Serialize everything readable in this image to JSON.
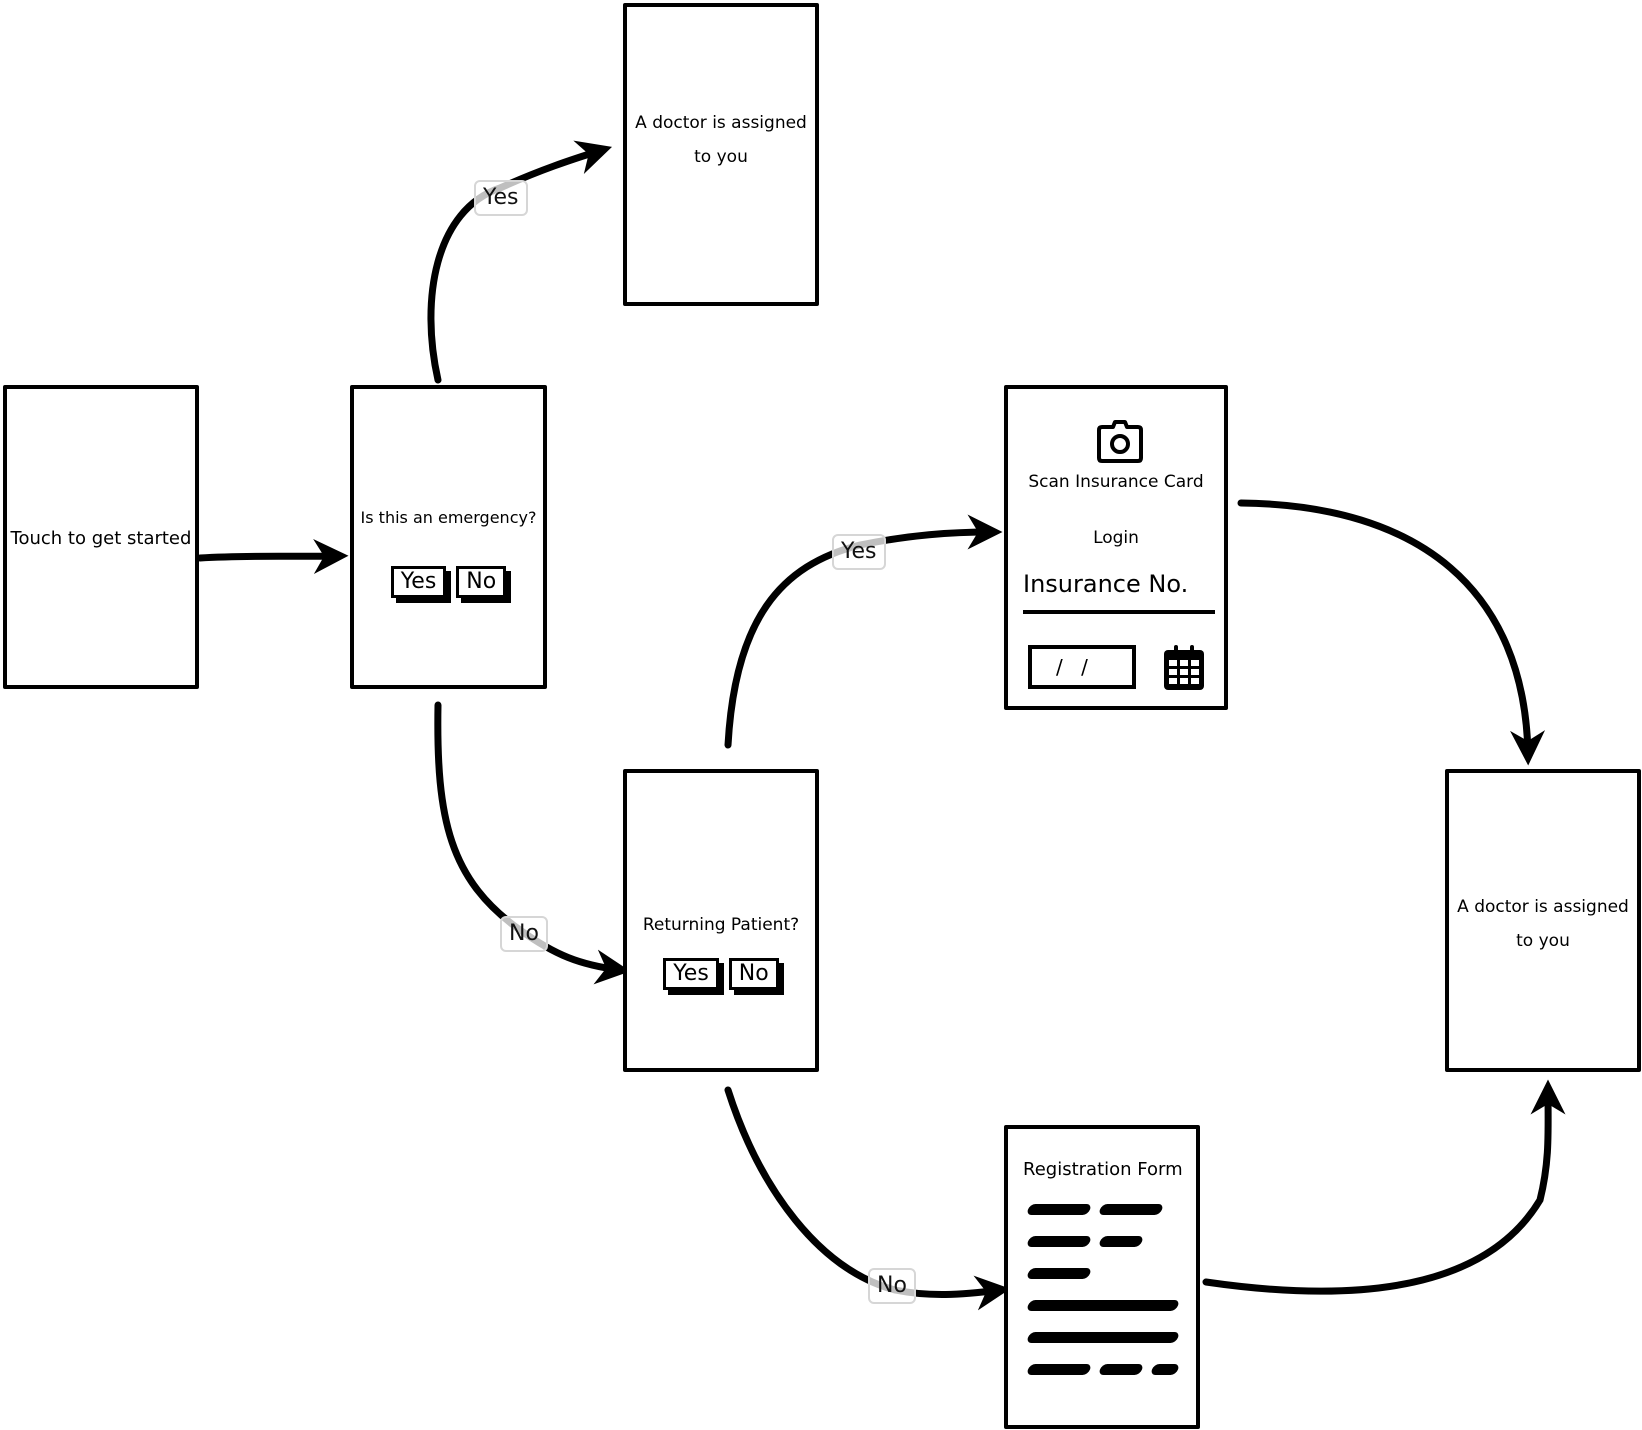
{
  "diagram": {
    "type": "wireframe-flow",
    "screens": {
      "start": {
        "text": "Touch to get started"
      },
      "emergency": {
        "question": "Is this an emergency?",
        "yes_label": "Yes",
        "no_label": "No"
      },
      "doctor_top": {
        "line1": "A doctor is assigned",
        "line2": "to you"
      },
      "returning": {
        "question": "Returning Patient?",
        "yes_label": "Yes",
        "no_label": "No"
      },
      "insurance": {
        "scan_label": "Scan Insurance Card",
        "login_label": "Login",
        "insurance_no_label": "Insurance No.",
        "date_value": "/ /",
        "camera_icon": "camera-icon",
        "calendar_icon": "calendar-icon"
      },
      "registration": {
        "title": "Registration Form",
        "scribble_lines": 6
      },
      "doctor_right": {
        "line1": "A doctor is assigned",
        "line2": "to you"
      }
    },
    "edges": [
      {
        "from": "start",
        "to": "emergency",
        "label": ""
      },
      {
        "from": "emergency",
        "to": "doctor_top",
        "label": "Yes"
      },
      {
        "from": "emergency",
        "to": "returning",
        "label": "No"
      },
      {
        "from": "returning",
        "to": "insurance",
        "label": "Yes"
      },
      {
        "from": "returning",
        "to": "registration",
        "label": "No"
      },
      {
        "from": "insurance",
        "to": "doctor_right",
        "label": ""
      },
      {
        "from": "registration",
        "to": "doctor_right",
        "label": ""
      }
    ]
  }
}
